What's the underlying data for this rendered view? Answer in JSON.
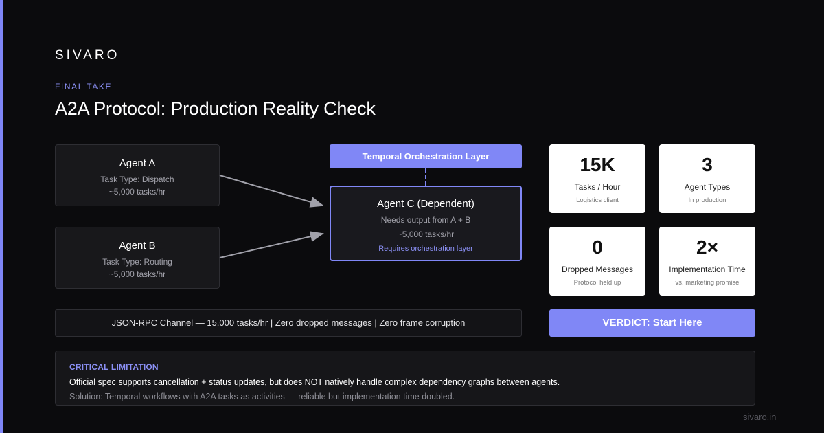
{
  "brand": "SIVARO",
  "eyebrow": "FINAL TAKE",
  "title": "A2A Protocol: Production Reality Check",
  "diagram": {
    "agent_a": {
      "name": "Agent A",
      "task_type": "Task Type: Dispatch",
      "throughput": "~5,000 tasks/hr"
    },
    "agent_b": {
      "name": "Agent B",
      "task_type": "Task Type: Routing",
      "throughput": "~5,000 tasks/hr"
    },
    "orchestration_layer": "Temporal Orchestration Layer",
    "agent_c": {
      "name": "Agent C (Dependent)",
      "needs": "Needs output from A + B",
      "throughput": "~5,000 tasks/hr",
      "note": "Requires orchestration layer"
    },
    "channel": "JSON-RPC Channel — 15,000 tasks/hr | Zero dropped messages | Zero frame corruption",
    "colors": {
      "accent": "#8087f6",
      "arrow": "#a1a1aa"
    }
  },
  "stats": [
    {
      "value": "15K",
      "label": "Tasks / Hour",
      "sub": "Logistics client"
    },
    {
      "value": "3",
      "label": "Agent Types",
      "sub": "In production"
    },
    {
      "value": "0",
      "label": "Dropped Messages",
      "sub": "Protocol held up"
    },
    {
      "value": "2×",
      "label": "Implementation Time",
      "sub": "vs. marketing promise"
    }
  ],
  "verdict": "VERDICT: Start Here",
  "limitation": {
    "heading": "CRITICAL LIMITATION",
    "body": "Official spec supports cancellation + status updates, but does NOT natively handle complex dependency graphs between agents.",
    "solution": "Solution: Temporal workflows with A2A tasks as activities — reliable but implementation time doubled."
  },
  "footer": "sivaro.in"
}
